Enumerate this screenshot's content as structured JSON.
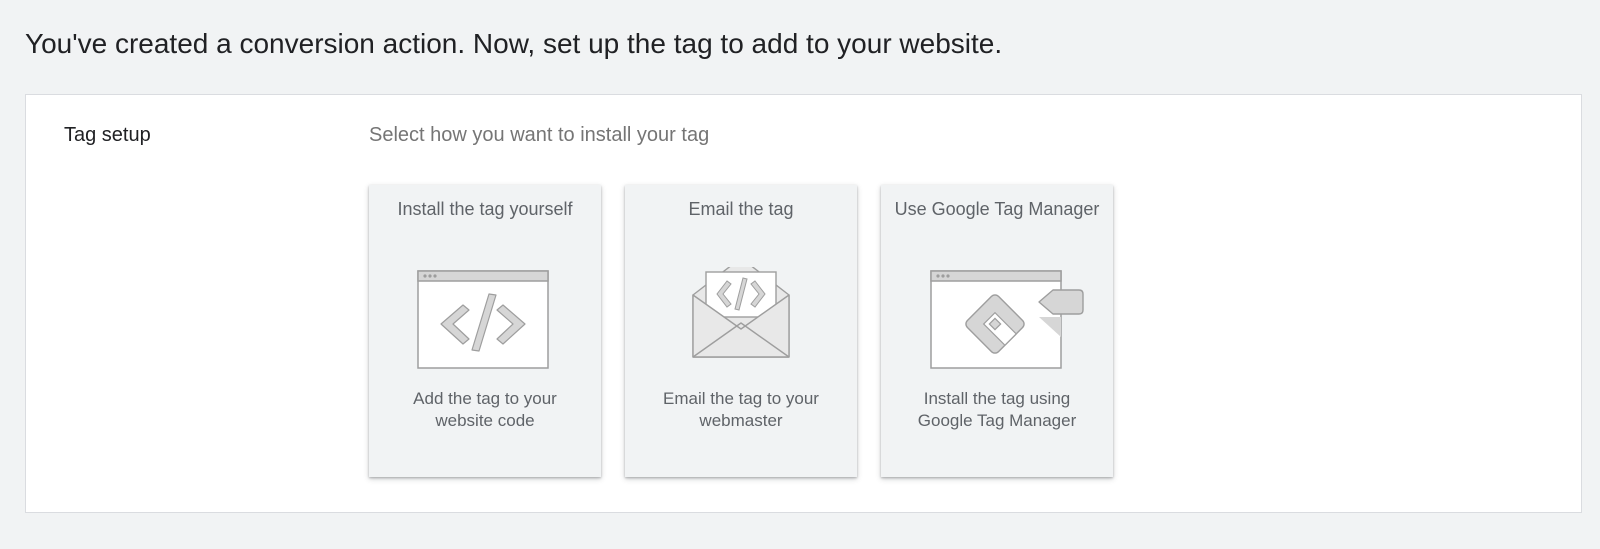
{
  "page": {
    "heading": "You've created a conversion action. Now, set up the tag to add to your website."
  },
  "tag_setup": {
    "label": "Tag setup",
    "prompt": "Select how you want to install your tag",
    "options": [
      {
        "title": "Install the tag yourself",
        "desc_line1": "Add the tag to your",
        "desc_line2": "website code",
        "icon": "browser-code-icon"
      },
      {
        "title": "Email the tag",
        "desc_line1": "Email the tag to your",
        "desc_line2": "webmaster",
        "icon": "envelope-code-icon"
      },
      {
        "title": "Use Google Tag Manager",
        "desc_line1": "Install the tag using",
        "desc_line2": "Google Tag Manager",
        "icon": "tag-manager-icon"
      }
    ]
  },
  "colors": {
    "background": "#f1f3f4",
    "card": "#f1f3f4",
    "panel": "#ffffff",
    "illustration_stroke": "#9e9e9e",
    "illustration_fill": "#d6d6d6"
  }
}
